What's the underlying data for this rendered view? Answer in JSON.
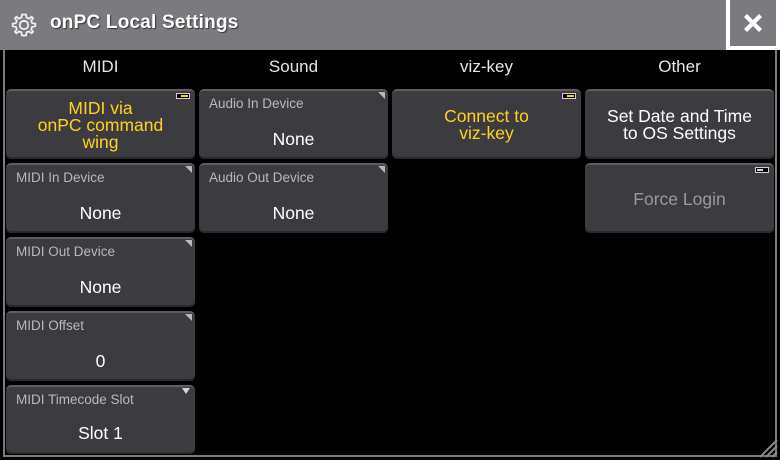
{
  "window": {
    "title": "onPC Local Settings"
  },
  "columns": {
    "midi": "MIDI",
    "sound": "Sound",
    "vizkey": "viz-key",
    "other": "Other"
  },
  "midi": {
    "via_wing": "MIDI via\nonPC command\nwing",
    "in_device": {
      "label": "MIDI In Device",
      "value": "None"
    },
    "out_device": {
      "label": "MIDI Out Device",
      "value": "None"
    },
    "offset": {
      "label": "MIDI Offset",
      "value": "0"
    },
    "timecode_slot": {
      "label": "MIDI Timecode Slot",
      "value": "Slot 1"
    }
  },
  "sound": {
    "audio_in": {
      "label": "Audio In Device",
      "value": "None"
    },
    "audio_out": {
      "label": "Audio Out Device",
      "value": "None"
    }
  },
  "vizkey": {
    "connect": "Connect to\nviz-key"
  },
  "other": {
    "set_date": "Set Date and Time\nto OS Settings",
    "force_login": "Force Login"
  },
  "colors": {
    "accent_yellow": "#ffd21e",
    "button_bg": "#3c3c40",
    "titlebar": "#7b7b7f"
  },
  "icons": {
    "title": "gear-icon",
    "close": "close-icon",
    "resize": "resize-grip-icon"
  }
}
